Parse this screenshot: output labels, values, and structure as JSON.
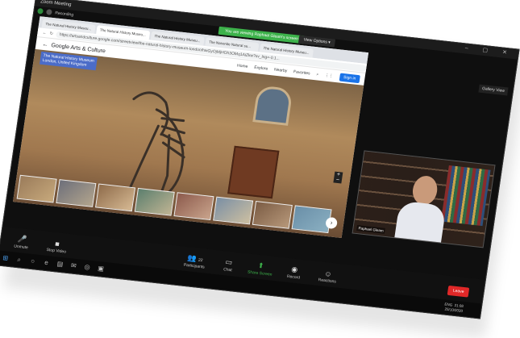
{
  "window": {
    "title": "Zoom Meeting",
    "recording": "Recording"
  },
  "banner": {
    "share_text": "You are viewing Raphael Gleam's screen",
    "view_options": "View Options ▾"
  },
  "gallery_view": "Gallery View",
  "browser": {
    "tabs": [
      "The Natural History Museu...",
      "The Natural History Museu...",
      "The Natural History Museu...",
      "The Nasonite Natural su...",
      "The Natural History Museu..."
    ],
    "url": "https://artsandculture.google.com/streetview/the-natural-history-museum-london/hwGyOjMjHOh3OMq1AiZkw?sv_lng=-0.1...",
    "brand": "Google Arts & Culture",
    "nav": {
      "home": "Home",
      "explore": "Explore",
      "nearby": "Nearby",
      "favorites": "Favorites",
      "signin": "Sign in"
    },
    "place_label": "The Natural History Museum",
    "place_sublabel": "London, United Kingdom"
  },
  "video": {
    "participant": "Raphael Gleam"
  },
  "controls": {
    "unmute": "Unmute",
    "stop_video": "Stop Video",
    "participants": "Participants",
    "participants_count": "22",
    "chat": "Chat",
    "share_screen": "Share Screen",
    "record": "Record",
    "reactions": "Reactions",
    "leave": "Leave"
  },
  "tray": {
    "lang": "ENG",
    "time": "21:08",
    "date": "25/10/2020"
  }
}
